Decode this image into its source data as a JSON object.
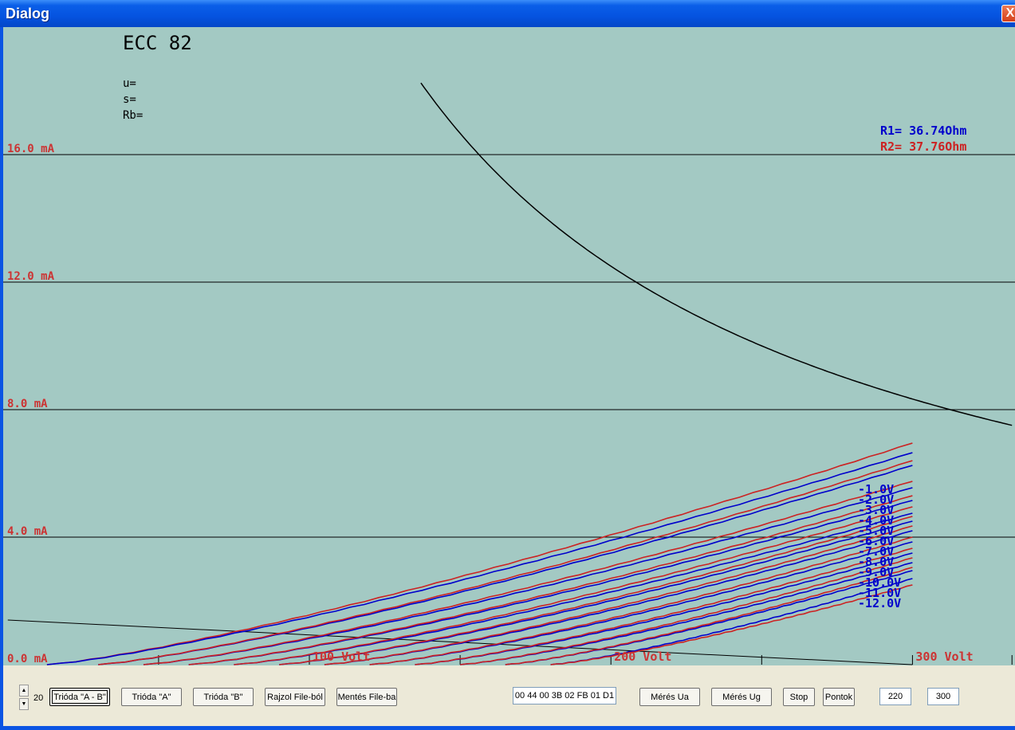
{
  "window": {
    "title": "Dialog",
    "close_glyph": "X"
  },
  "chart_data": {
    "type": "line",
    "title": "ECC 82",
    "params": [
      "u=",
      "s=",
      "Rb="
    ],
    "xlim": [
      -1,
      334
    ],
    "ylim": [
      0,
      20
    ],
    "x_ticks": [
      {
        "value": 100,
        "label": "100 Volt"
      },
      {
        "value": 200,
        "label": "200 Volt"
      },
      {
        "value": 300,
        "label": "300 Volt"
      }
    ],
    "x_minor_ticks": [
      50,
      150,
      250,
      333
    ],
    "y_ticks": [
      {
        "value": 0,
        "label": "0.0 mA"
      },
      {
        "value": 4,
        "label": "4.0 mA"
      },
      {
        "value": 8,
        "label": "8.0 mA"
      },
      {
        "value": 12,
        "label": "12.0 mA"
      },
      {
        "value": 16,
        "label": "16.0 mA"
      }
    ],
    "grid": "horizontal",
    "power_curve": {
      "label": "",
      "power_W": 2.5,
      "x": [
        137,
        150,
        175,
        200,
        225,
        250,
        275,
        300,
        325,
        333
      ],
      "y": [
        18.25,
        16.67,
        14.29,
        12.5,
        11.11,
        10.0,
        9.09,
        8.33,
        7.69,
        7.5
      ]
    },
    "load_line": {
      "x": [
        0,
        300
      ],
      "y": [
        1.4,
        0.0
      ]
    },
    "resistance_labels": [
      {
        "text": "R1= 36.74Ohm",
        "color": "#0000cc"
      },
      {
        "text": "R2= 37.76Ohm",
        "color": "#cc2222"
      }
    ],
    "grid_voltage_labels": [
      "-1.0V",
      "-2.0V",
      "-3.0V",
      "-4.0V",
      "-5.0V",
      "-6.0V",
      "-7.0V",
      "-8.0V",
      "-9.0V",
      "-10.0V",
      "-11.0V",
      "-12.0V"
    ],
    "series": [
      {
        "color": "#cc2222",
        "x": [
          13,
          300
        ],
        "y": [
          0,
          6.95
        ]
      },
      {
        "color": "#0000cc",
        "x": [
          13,
          300
        ],
        "y": [
          0,
          6.65
        ]
      },
      {
        "color": "#0000cc",
        "x": [
          30,
          300
        ],
        "y": [
          0,
          6.25
        ]
      },
      {
        "color": "#cc2222",
        "x": [
          30,
          300
        ],
        "y": [
          0,
          6.4
        ]
      },
      {
        "color": "#0000cc",
        "x": [
          45,
          300
        ],
        "y": [
          0,
          5.55
        ]
      },
      {
        "color": "#cc2222",
        "x": [
          45,
          300
        ],
        "y": [
          0,
          5.75
        ]
      },
      {
        "color": "#0000cc",
        "x": [
          60,
          300
        ],
        "y": [
          0,
          5.15
        ]
      },
      {
        "color": "#cc2222",
        "x": [
          60,
          300
        ],
        "y": [
          0,
          5.3
        ]
      },
      {
        "color": "#0000cc",
        "x": [
          75,
          300
        ],
        "y": [
          0,
          4.75
        ]
      },
      {
        "color": "#cc2222",
        "x": [
          75,
          300
        ],
        "y": [
          0,
          4.95
        ]
      },
      {
        "color": "#0000cc",
        "x": [
          90,
          300
        ],
        "y": [
          0,
          4.5
        ]
      },
      {
        "color": "#cc2222",
        "x": [
          90,
          300
        ],
        "y": [
          0,
          4.65
        ]
      },
      {
        "color": "#0000cc",
        "x": [
          105,
          300
        ],
        "y": [
          0,
          4.2
        ]
      },
      {
        "color": "#cc2222",
        "x": [
          105,
          300
        ],
        "y": [
          0,
          4.35
        ]
      },
      {
        "color": "#0000cc",
        "x": [
          120,
          300
        ],
        "y": [
          0,
          3.85
        ]
      },
      {
        "color": "#cc2222",
        "x": [
          120,
          300
        ],
        "y": [
          0,
          4.0
        ]
      },
      {
        "color": "#0000cc",
        "x": [
          135,
          300
        ],
        "y": [
          0,
          3.5
        ]
      },
      {
        "color": "#cc2222",
        "x": [
          135,
          300
        ],
        "y": [
          0,
          3.65
        ]
      },
      {
        "color": "#0000cc",
        "x": [
          150,
          300
        ],
        "y": [
          0,
          3.2
        ]
      },
      {
        "color": "#cc2222",
        "x": [
          150,
          300
        ],
        "y": [
          0,
          3.35
        ]
      },
      {
        "color": "#0000cc",
        "x": [
          165,
          300
        ],
        "y": [
          0,
          2.95
        ]
      },
      {
        "color": "#cc2222",
        "x": [
          165,
          300
        ],
        "y": [
          0,
          3.05
        ]
      },
      {
        "color": "#0000cc",
        "x": [
          180,
          300
        ],
        "y": [
          0,
          2.7
        ]
      },
      {
        "color": "#cc2222",
        "x": [
          180,
          300
        ],
        "y": [
          0,
          2.5
        ]
      }
    ]
  },
  "controls": {
    "spin_value": "20",
    "spin_up": "▲",
    "spin_down": "▼",
    "buttons": {
      "trioda_ab": "Trióda \"A - B\"",
      "trioda_a": "Trióda  \"A\"",
      "trioda_b": "Trióda  \"B\"",
      "rajzol": "Rajzol File-ból",
      "mentes": "Mentés File-ba",
      "meres_ua": "Mérés Ua",
      "meres_ug": "Mérés Ug",
      "stop": "Stop",
      "pontok": "Pontok"
    },
    "hex_value": "00 44 00 3B 02 FB 01 D1",
    "field_1": "220",
    "field_2": "300"
  }
}
